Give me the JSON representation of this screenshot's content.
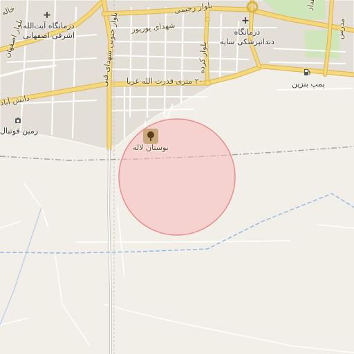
{
  "map": {
    "colors": {
      "background": "#f2efe9",
      "major_road": "#f6d87c",
      "major_road_casing": "#d9b44a",
      "minor_road": "#ffffff",
      "block_fill": "#e2ddd4",
      "park": "#c8e2b0",
      "boundary": "#a79aa6",
      "waterway": "#8fb6e6",
      "circle_fill": "#f7b9b9",
      "circle_stroke": "#e88888"
    },
    "labels": {
      "road_rahimi": "بلوار رحیمی",
      "road_shohada_pourpour": "شهدای پورپور",
      "road_20metri_ghodratollah": "۲۰ متری قدرت الله غربا",
      "road_javadi": "بلوار جنوبی شهدای قبی",
      "road_kardeh": "بلوار کرده",
      "road_khaleh": "خاله",
      "road_daneshabad": "دانش آباد",
      "road_esfahani": "بلوار اصفهان",
      "road_madaress": "مدرس",
      "road_far_right": "هداد",
      "clinic_ayatollah_1": "درمانگاه آیت‌الله",
      "clinic_ayatollah_2": "اشرفی اصفهانی",
      "clinic_saye_1": "درمانگاه",
      "clinic_saye_2": "دندانپزشکی سایه",
      "fuel_station": "پمپ بنزین",
      "football_field": "زمین فوتبال",
      "park_laleh": "بوستان لاله"
    },
    "icons": {
      "clinic_1": "medical-cross-icon",
      "clinic_2": "medical-cross-icon",
      "fuel": "fuel-pump-icon",
      "football": "football-field-icon",
      "park": "park-tree-icon"
    }
  }
}
